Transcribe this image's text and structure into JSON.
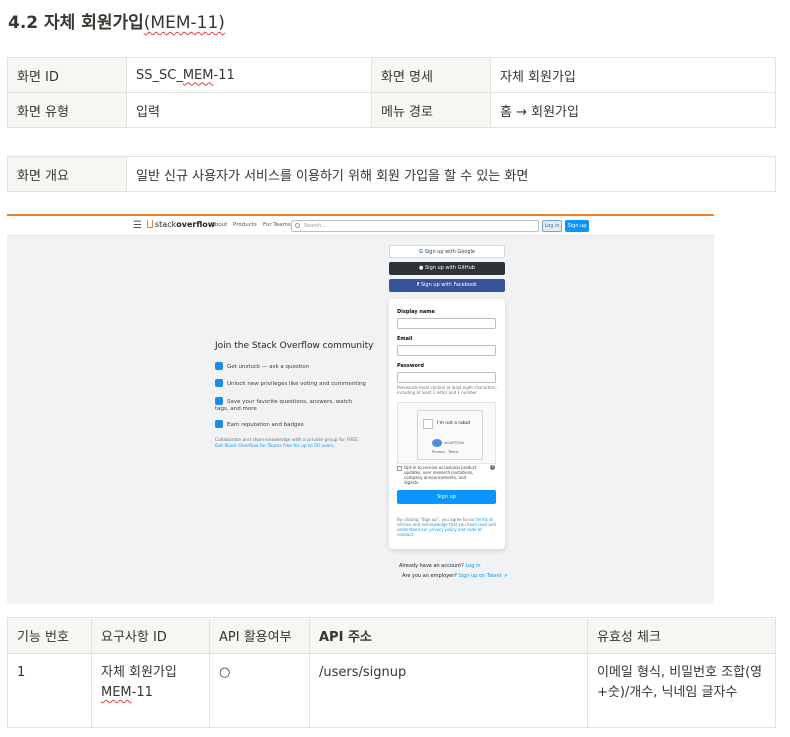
{
  "section": {
    "title_main": "4.2 자체 회원가입",
    "title_code": "(MEM-11)"
  },
  "screen_info": {
    "rows": [
      {
        "label1": "화면 ID",
        "value1_prefix": "SS_SC_",
        "value1_code": "MEM",
        "value1_suffix": "-11",
        "label2": "화면 명세",
        "value2": "자체 회원가입"
      },
      {
        "label1": "화면 유형",
        "value1": "입력",
        "label2": "메뉴 경로",
        "value2": "홈 → 회원가입"
      }
    ]
  },
  "overview": {
    "label": "화면 개요",
    "value": "일반 신규 사용자가 서비스를 이용하기 위해 회원 가입을 할 수 있는 화면"
  },
  "mockup": {
    "logo_light": "stack",
    "logo_bold": "overflow",
    "nav": [
      "About",
      "Products",
      "For Teams"
    ],
    "search_placeholder": "Search...",
    "login": "Log in",
    "signup": "Sign up",
    "join_title": "Join the Stack Overflow community",
    "features": [
      "Get unstuck — ask a question",
      "Unlock new privileges like voting and commenting",
      "Save your favorite questions, answers, watch tags, and more",
      "Earn reputation and badges"
    ],
    "collab_text": "Collaborate and share knowledge with a private group for FREE.",
    "collab_link": "Get Stack Overflow for Teams free for up to 50 users.",
    "google": "Sign up with Google",
    "github": "Sign up with GitHub",
    "facebook": "Sign up with Facebook",
    "display_name": "Display name",
    "email": "Email",
    "password": "Password",
    "password_help": "Passwords must contain at least eight characters, including at least 1 letter and 1 number.",
    "captcha_text": "I'm not a robot",
    "captcha_brand": "reCAPTCHA",
    "captcha_terms": "Privacy - Terms",
    "optin": "Opt-in to receive occasional product updates, user research invitations, company announcements, and digests.",
    "submit": "Sign up",
    "terms_prefix": "By clicking “Sign up”, you agree to our ",
    "terms_link": "terms of service and acknowledge that you have read and understand our privacy policy and code of conduct.",
    "already": "Already have an account? ",
    "already_link": "Log in",
    "employer": "Are you an employer? ",
    "employer_link": "Sign up on Talent"
  },
  "requirements": {
    "headers": [
      "기능 번호",
      "요구사항 ID",
      "API 활용여부",
      "API 주소",
      "유효성 체크"
    ],
    "rows": [
      {
        "no": "1",
        "req_line1": "자체 회원가입",
        "req_code": "MEM",
        "req_suffix": "-11",
        "api_used": "○",
        "api_url": "/users/signup",
        "validation": "이메일 형식, 비밀번호 조합(영+숫)/개수, 닉네임 글자수"
      }
    ]
  }
}
